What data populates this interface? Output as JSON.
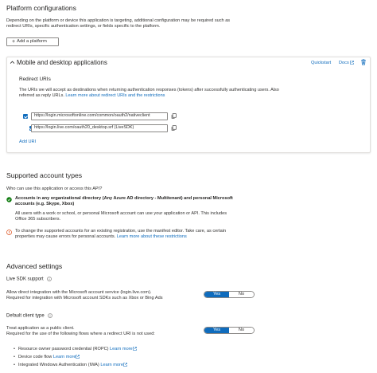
{
  "platform_config": {
    "title": "Platform configurations",
    "description_line1": "Depending on the platform or device this application is targeting, additional configuration may be required such as",
    "description_line2": "redirect URIs, specific authentication settings, or fields specific to the platform.",
    "add_platform_label": "Add a platform"
  },
  "mobile_desktop": {
    "title": "Mobile and desktop applications",
    "quickstart_label": "Quickstart",
    "docs_label": "Docs",
    "redirect_uris_heading": "Redirect URIs",
    "redirect_desc_line1": "The URIs we will accept as destinations when returning authentication responses (tokens) after successfully authenticating users. Also",
    "redirect_desc_line2_prefix": "referred as reply URLs.",
    "redirect_desc_link": "Learn more about redirect URIs and the restrictions",
    "uris": [
      {
        "value": "https://login.microsoftonline.com/common/oauth2/nativeclient",
        "checked": true
      },
      {
        "value": "https://login.live.com/oauth20_desktop.srf (LiveSDK)",
        "checked": true
      }
    ],
    "add_uri_label": "Add URI"
  },
  "supported_accounts": {
    "title": "Supported account types",
    "question": "Who can use this application or access this API?",
    "selected_line1": "Accounts in any organizational directory (Any Azure AD directory - Multitenant) and personal Microsoft",
    "selected_line2": "accounts (e.g. Skype, Xbox)",
    "explain_line1": "All users with a work or school, or personal Microsoft account can use your application or API. This includes",
    "explain_line2": "Office 365 subscribers.",
    "warning_line1": "To change the supported accounts for an existing registration, use the manifest editor. Take care, as certain",
    "warning_line2_prefix": "properties may cause errors for personal accounts.",
    "warning_link": "Learn more about these restrictions"
  },
  "advanced": {
    "title": "Advanced settings",
    "live_sdk_heading": "Live SDK support",
    "live_sdk_line1": "Allow direct integration with the Microsoft account service (login.live.com).",
    "live_sdk_line2": "Required for integration with Microsoft account SDKs such as Xbox or Bing Ads",
    "default_client_heading": "Default client type",
    "public_client_line1": "Treat application as a public client.",
    "public_client_line2": "Required for the use of the following flows where a redirect URI is not used:",
    "yes_label": "Yes",
    "no_label": "No",
    "flows": [
      {
        "label": "Resource owner password credential (ROPC)",
        "link": "Learn more"
      },
      {
        "label": "Device code flow",
        "link": "Learn more"
      },
      {
        "label": "Integrated Windows Authentication (IWA)",
        "link": "Learn more"
      }
    ]
  },
  "colors": {
    "accent": "#0f6cbd",
    "success": "#107c10",
    "warning": "#d83b01"
  }
}
